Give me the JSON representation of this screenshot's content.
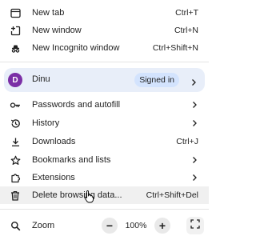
{
  "menu": {
    "new_tab": {
      "label": "New tab",
      "shortcut": "Ctrl+T",
      "icon": "new-tab-icon"
    },
    "new_window": {
      "label": "New window",
      "shortcut": "Ctrl+N",
      "icon": "new-window-icon"
    },
    "new_incognito": {
      "label": "New Incognito window",
      "shortcut": "Ctrl+Shift+N",
      "icon": "incognito-icon"
    },
    "profile": {
      "avatar_letter": "D",
      "name": "Dinu",
      "status": "Signed in",
      "avatar_color": "#7b2fa6"
    },
    "passwords": {
      "label": "Passwords and autofill",
      "icon": "key-icon"
    },
    "history": {
      "label": "History",
      "icon": "history-icon"
    },
    "downloads": {
      "label": "Downloads",
      "shortcut": "Ctrl+J",
      "icon": "download-icon"
    },
    "bookmarks": {
      "label": "Bookmarks and lists",
      "icon": "star-icon"
    },
    "extensions": {
      "label": "Extensions",
      "icon": "puzzle-icon"
    },
    "delete_browsing": {
      "label": "Delete browsing data...",
      "shortcut": "Ctrl+Shift+Del",
      "icon": "trash-icon"
    },
    "zoom": {
      "label": "Zoom",
      "level": "100%",
      "minus": "−",
      "plus": "+",
      "icon": "zoom-icon"
    }
  },
  "colors": {
    "profile_bg": "#e8eef9",
    "signed_in_pill": "#d3e3fd",
    "hover_row": "#f0f0f0"
  }
}
